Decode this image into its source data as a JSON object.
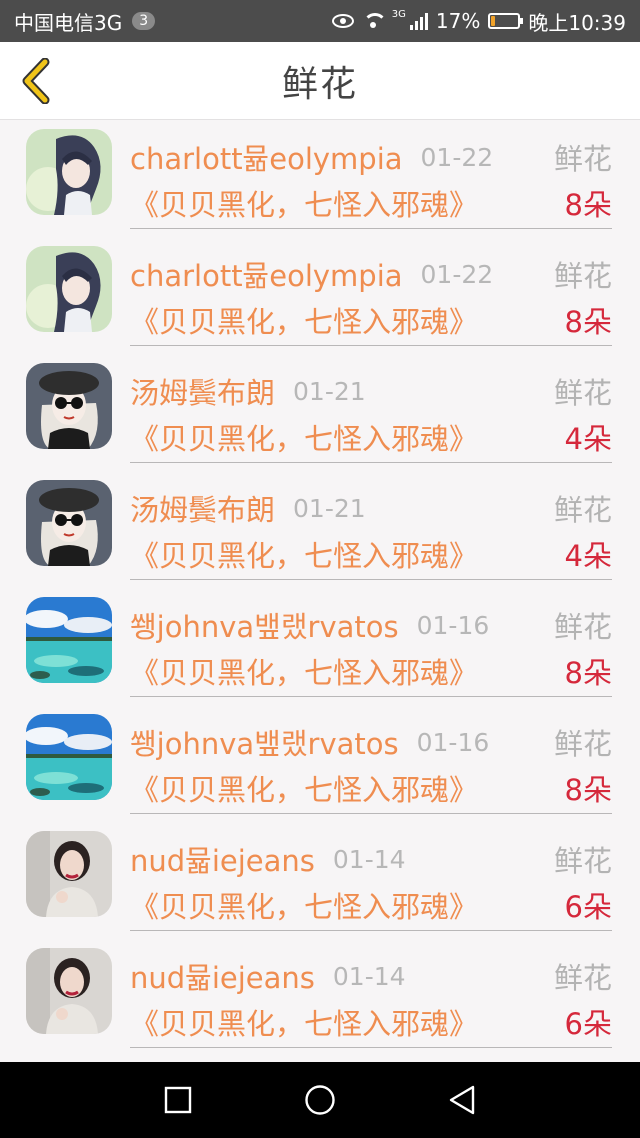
{
  "status_bar": {
    "carrier": "中国电信3G",
    "sim_badge": "3",
    "network": "3G",
    "battery": "17%",
    "battery_level": 0.17,
    "time": "晚上10:39"
  },
  "header": {
    "title": "鲜花",
    "back_icon": "chevron-left-icon",
    "accent_color": "#f0c419"
  },
  "colors": {
    "name": "#ef8d50",
    "count": "#d5283b",
    "muted": "#b3b3b3"
  },
  "records": [
    {
      "name": "charlott뮮eolympia",
      "date": "01-22",
      "gift": "鲜花",
      "book": "《贝贝黑化，七怪入邪魂》",
      "count": "8朵"
    },
    {
      "name": "charlott뮮eolympia",
      "date": "01-22",
      "gift": "鲜花",
      "book": "《贝贝黑化，七怪入邪魂》",
      "count": "8朵"
    },
    {
      "name": "汤姆鬓布朗",
      "date": "01-21",
      "gift": "鲜花",
      "book": "《贝贝黑化，七怪入邪魂》",
      "count": "4朵"
    },
    {
      "name": "汤姆鬓布朗",
      "date": "01-21",
      "gift": "鲜花",
      "book": "《贝贝黑化，七怪入邪魂》",
      "count": "4朵"
    },
    {
      "name": "쐥johnva뱊랬rvatos",
      "date": "01-16",
      "gift": "鲜花",
      "book": "《贝贝黑化，七怪入邪魂》",
      "count": "8朵"
    },
    {
      "name": "쐥johnva뱊랬rvatos",
      "date": "01-16",
      "gift": "鲜花",
      "book": "《贝贝黑化，七怪入邪魂》",
      "count": "8朵"
    },
    {
      "name": "nud뮯iejeans",
      "date": "01-14",
      "gift": "鲜花",
      "book": "《贝贝黑化，七怪入邪魂》",
      "count": "6朵"
    },
    {
      "name": "nud뮯iejeans",
      "date": "01-14",
      "gift": "鲜花",
      "book": "《贝贝黑化，七怪入邪魂》",
      "count": "6朵"
    }
  ],
  "nav": {
    "recent_icon": "square-icon",
    "home_icon": "circle-icon",
    "back_icon": "triangle-back-icon"
  }
}
